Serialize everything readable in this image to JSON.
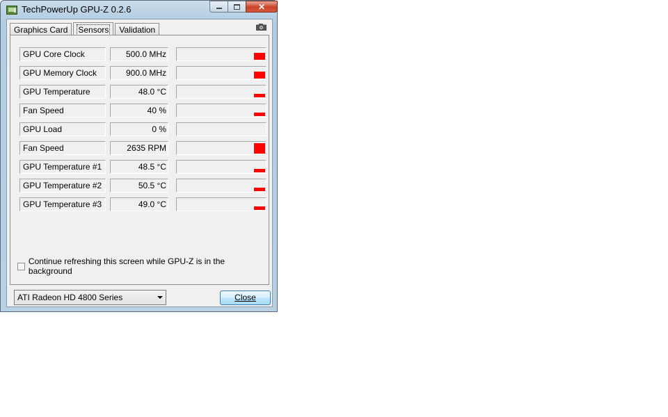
{
  "window": {
    "title": "TechPowerUp GPU-Z 0.2.6",
    "close_glyph": "✕"
  },
  "tabs": [
    {
      "label": "Graphics Card",
      "active": false
    },
    {
      "label": "Sensors",
      "active": true
    },
    {
      "label": "Validation",
      "active": false
    }
  ],
  "sensors": [
    {
      "name": "GPU Core Clock",
      "value": "500.0 MHz",
      "graph_level": 0.55
    },
    {
      "name": "GPU Memory Clock",
      "value": "900.0 MHz",
      "graph_level": 0.55
    },
    {
      "name": "GPU Temperature",
      "value": "48.0 °C",
      "graph_level": 0.3
    },
    {
      "name": "Fan Speed",
      "value": "40 %",
      "graph_level": 0.3
    },
    {
      "name": "GPU Load",
      "value": "0 %",
      "graph_level": 0
    },
    {
      "name": "Fan Speed",
      "value": "2635 RPM",
      "graph_level": 0.85
    },
    {
      "name": "GPU Temperature #1",
      "value": "48.5 °C",
      "graph_level": 0.3
    },
    {
      "name": "GPU Temperature #2",
      "value": "50.5 °C",
      "graph_level": 0.3
    },
    {
      "name": "GPU Temperature #3",
      "value": "49.0 °C",
      "graph_level": 0.3
    }
  ],
  "refresh_option": {
    "label": "Continue refreshing this screen while GPU-Z is in the background",
    "checked": false
  },
  "gpu_select": {
    "value": "ATI Radeon HD 4800 Series"
  },
  "close_button": {
    "label": "Close"
  },
  "colors": {
    "graph_bar": "#ff0000"
  },
  "icons": {
    "camera": "camera-icon"
  }
}
